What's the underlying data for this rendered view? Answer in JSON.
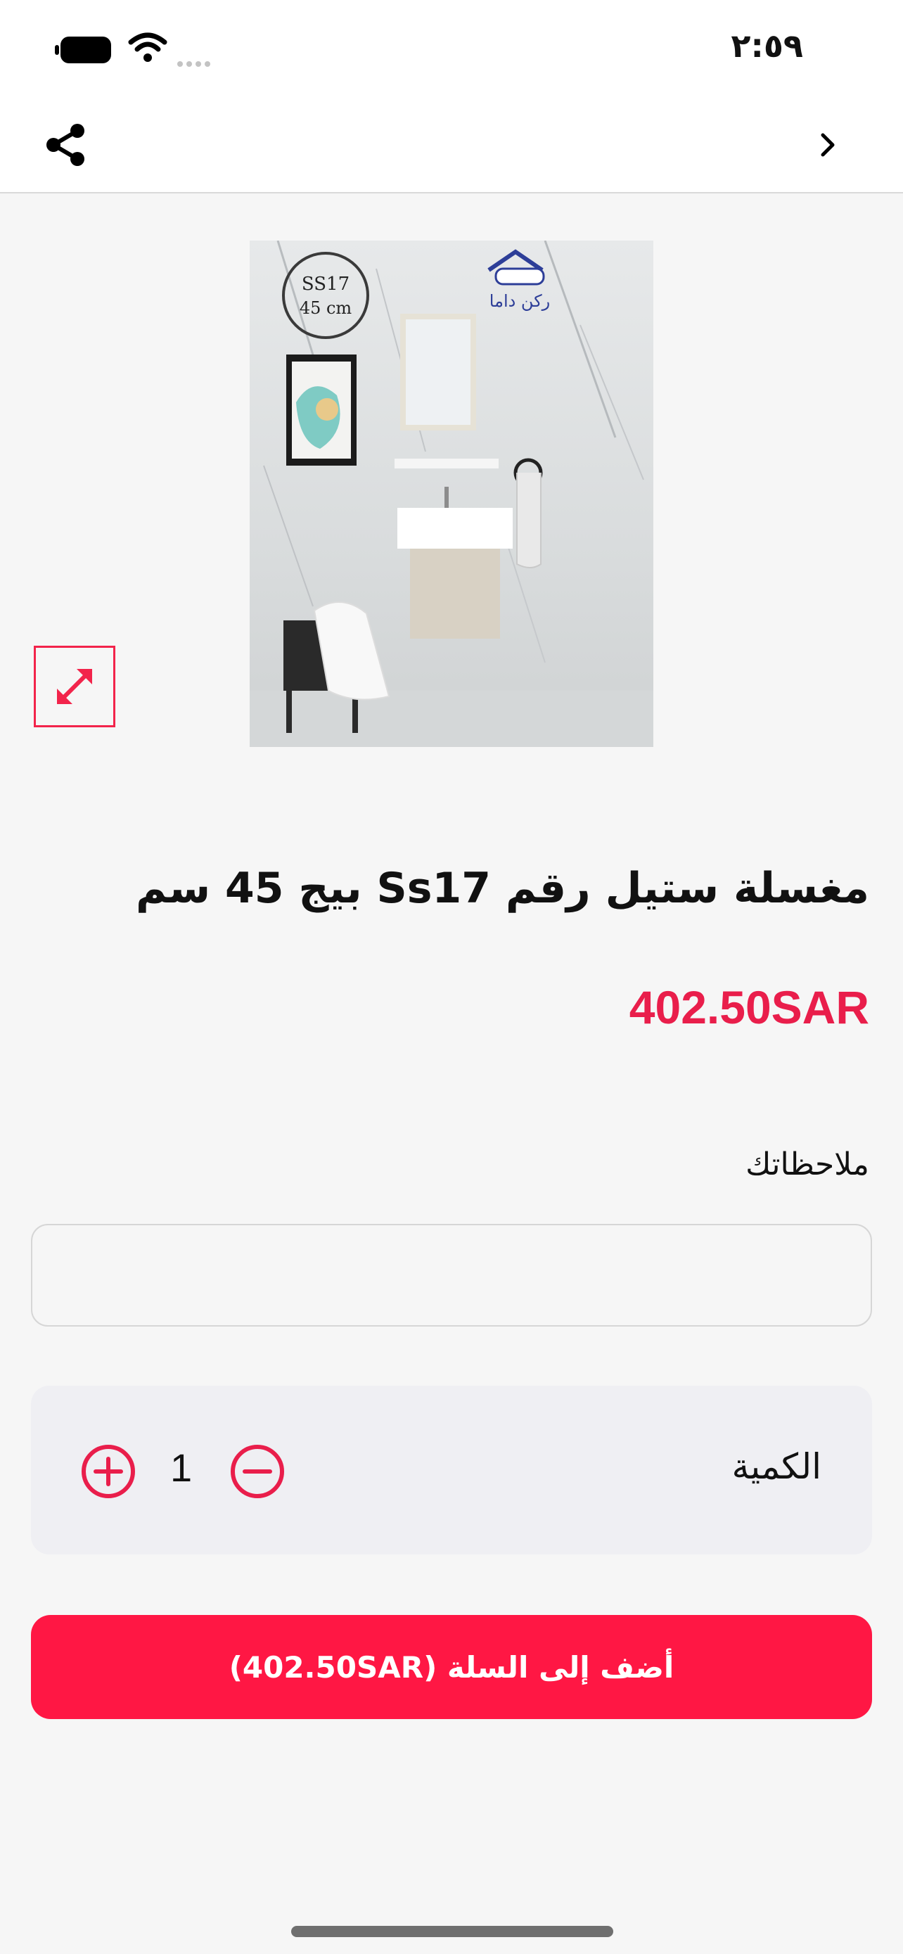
{
  "status_bar": {
    "time": "٢:٥٩"
  },
  "nav": {
    "share_icon": "share-icon",
    "back_icon": "chevron-right-icon"
  },
  "product": {
    "image_badge": {
      "line1": "SS17",
      "line2": "45 cm"
    },
    "image_logo": "ركن داما",
    "title": "مغسلة ستيل رقم Ss17 بيج 45 سم",
    "price": "402.50SAR"
  },
  "notes": {
    "label": "ملاحظاتك",
    "value": "",
    "placeholder": ""
  },
  "quantity": {
    "label": "الكمية",
    "value": "1"
  },
  "cart_button": {
    "label": "أضف إلى السلة (402.50SAR)"
  },
  "colors": {
    "accent": "#ff1744",
    "price": "#e91e4b"
  }
}
